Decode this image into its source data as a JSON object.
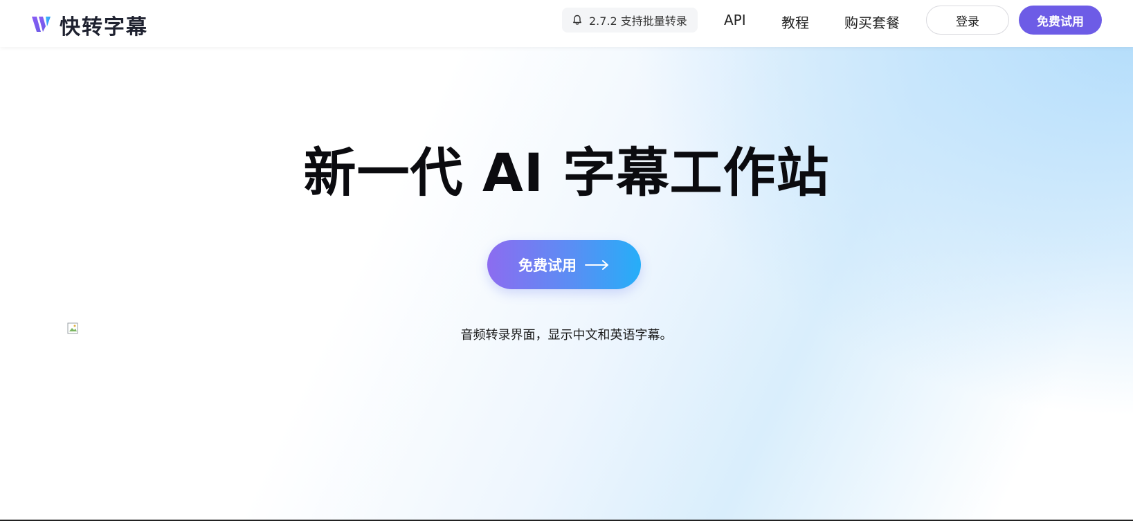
{
  "header": {
    "logo_text": "快转字幕",
    "logo_icon": "brand-logo-icon",
    "version_badge": "2.7.2 支持批量转录",
    "version_icon": "bell-icon",
    "nav": {
      "api": "API",
      "tutorial": "教程",
      "pricing": "购买套餐"
    },
    "login_label": "登录",
    "trial_label": "免费试用"
  },
  "hero": {
    "title": "新一代 AI 字幕工作站",
    "cta_label": "免费试用",
    "cta_icon": "arrow-right-icon",
    "image_caption": "音频转录界面，显示中文和英语字幕。"
  },
  "colors": {
    "accent": "#6d5ce6",
    "highlight_stroke": "#f7b23c",
    "cta_gradient_start": "#8c6cf0",
    "cta_gradient_end": "#26aef8"
  }
}
